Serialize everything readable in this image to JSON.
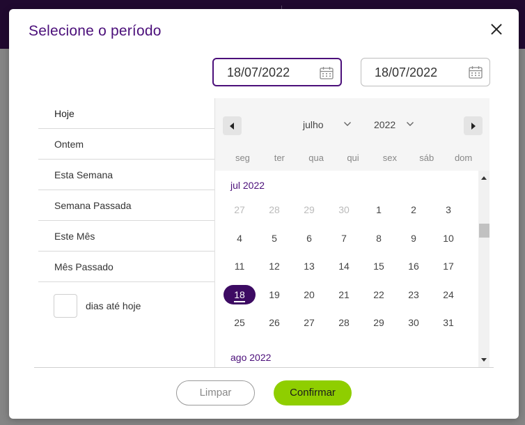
{
  "modal": {
    "title": "Selecione o período"
  },
  "date_range": {
    "start": "18/07/2022",
    "end": "18/07/2022"
  },
  "quick_options": [
    "Hoje",
    "Ontem",
    "Esta Semana",
    "Semana Passada",
    "Este Mês",
    "Mês Passado"
  ],
  "days_until_today": {
    "value": "",
    "label": "dias até hoje"
  },
  "calendar": {
    "month_select": "julho",
    "year_select": "2022",
    "weekdays": [
      "seg",
      "ter",
      "qua",
      "qui",
      "sex",
      "sáb",
      "dom"
    ],
    "months": [
      {
        "label": "jul 2022",
        "weeks": [
          [
            {
              "d": "27",
              "muted": true
            },
            {
              "d": "28",
              "muted": true
            },
            {
              "d": "29",
              "muted": true
            },
            {
              "d": "30",
              "muted": true
            },
            {
              "d": "1"
            },
            {
              "d": "2"
            },
            {
              "d": "3"
            }
          ],
          [
            {
              "d": "4"
            },
            {
              "d": "5"
            },
            {
              "d": "6"
            },
            {
              "d": "7"
            },
            {
              "d": "8"
            },
            {
              "d": "9"
            },
            {
              "d": "10"
            }
          ],
          [
            {
              "d": "11"
            },
            {
              "d": "12"
            },
            {
              "d": "13"
            },
            {
              "d": "14"
            },
            {
              "d": "15"
            },
            {
              "d": "16"
            },
            {
              "d": "17"
            }
          ],
          [
            {
              "d": "18",
              "selected": true
            },
            {
              "d": "19"
            },
            {
              "d": "20"
            },
            {
              "d": "21"
            },
            {
              "d": "22"
            },
            {
              "d": "23"
            },
            {
              "d": "24"
            }
          ],
          [
            {
              "d": "25"
            },
            {
              "d": "26"
            },
            {
              "d": "27"
            },
            {
              "d": "28"
            },
            {
              "d": "29"
            },
            {
              "d": "30"
            },
            {
              "d": "31"
            }
          ]
        ]
      },
      {
        "label": "ago 2022",
        "weeks": []
      }
    ]
  },
  "footer": {
    "clear_label": "Limpar",
    "confirm_label": "Confirmar"
  },
  "colors": {
    "brand_purple": "#4b0f7a",
    "selected_day": "#3d0b63",
    "confirm_green": "#8fce00"
  }
}
